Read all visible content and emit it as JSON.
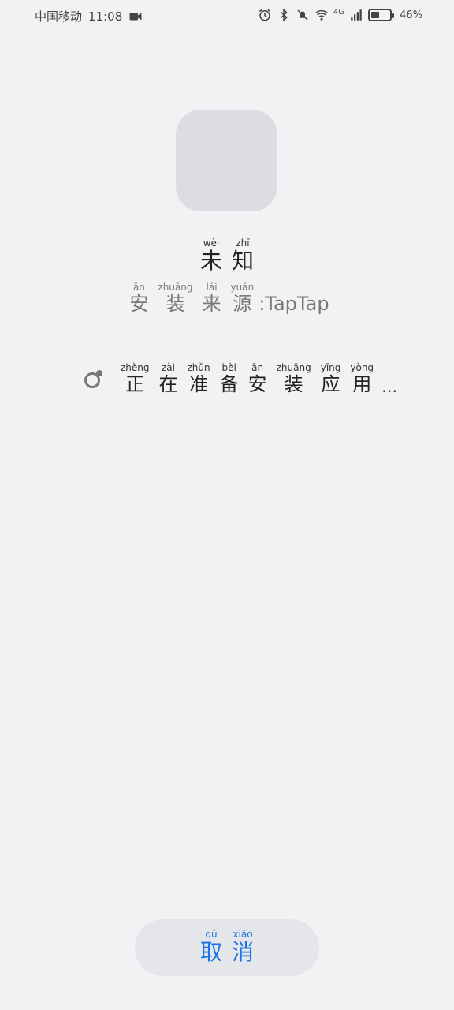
{
  "status_bar": {
    "carrier": "中国移动",
    "time": "11:08",
    "network": "4G",
    "battery_percent": "46%",
    "battery_level": 0.46,
    "icons": [
      "video-icon",
      "alarm-icon",
      "bluetooth-icon",
      "mute-icon",
      "wifi-icon",
      "signal-icon",
      "battery-icon"
    ]
  },
  "app": {
    "name": [
      {
        "char": "未",
        "pinyin": "wèi"
      },
      {
        "char": "知",
        "pinyin": "zhī"
      }
    ],
    "source_label": [
      {
        "char": "安",
        "pinyin": "ān"
      },
      {
        "char": "装",
        "pinyin": "zhuāng"
      },
      {
        "char": "来",
        "pinyin": "lái"
      },
      {
        "char": "源",
        "pinyin": "yuán"
      }
    ],
    "source_value": ":TapTap"
  },
  "progress": {
    "text": [
      {
        "char": "正",
        "pinyin": "zhèng"
      },
      {
        "char": "在",
        "pinyin": "zài"
      },
      {
        "char": "准",
        "pinyin": "zhǔn"
      },
      {
        "char": "备",
        "pinyin": "bèi"
      },
      {
        "char": "安",
        "pinyin": "ān"
      },
      {
        "char": "装",
        "pinyin": "zhuāng"
      },
      {
        "char": "应",
        "pinyin": "yīng"
      },
      {
        "char": "用",
        "pinyin": "yòng"
      }
    ],
    "ellipsis": "…"
  },
  "cancel_button": [
    {
      "char": "取",
      "pinyin": "qǔ"
    },
    {
      "char": "消",
      "pinyin": "xiāo"
    }
  ],
  "colors": {
    "background": "#f1f2f4",
    "accent": "#1a73e8"
  }
}
